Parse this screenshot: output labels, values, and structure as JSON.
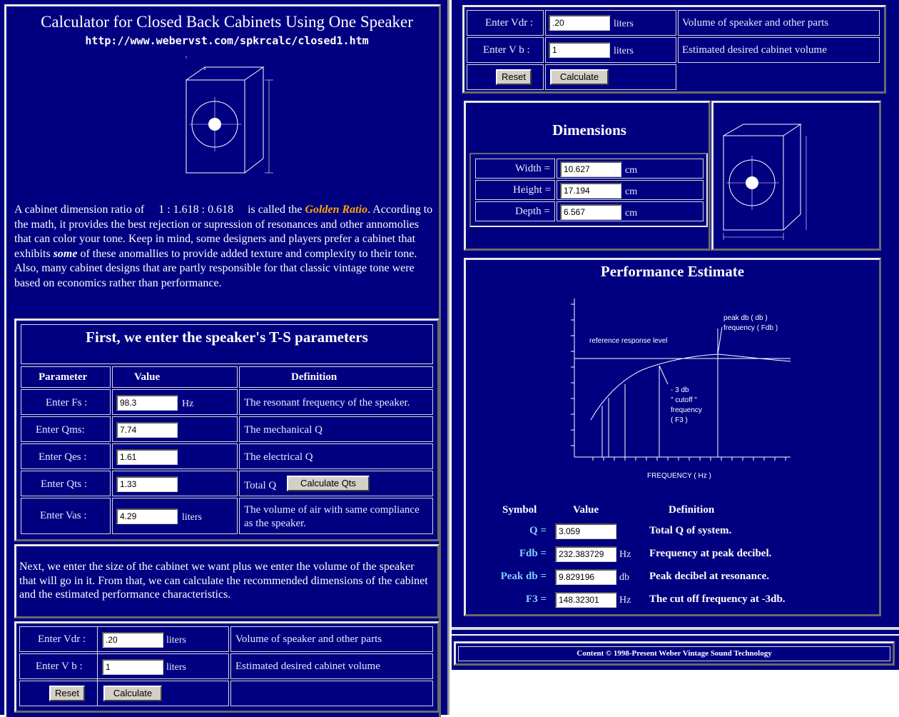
{
  "header": {
    "title": "Calculator for Closed Back Cabinets Using One Speaker",
    "url": "http://www.webervst.com/spkrcalc/closed1.htm"
  },
  "intro": {
    "p1": "A cabinet dimension ratio of",
    "ratio": "1 : 1.618 : 0.618",
    "p2": "is called the",
    "golden": "Golden Ratio",
    "p3": ". According to the math, it provides the best rejection or supression of resonances and other annomolies that can color your tone. Keep in mind, some designers and players prefer a cabinet that exhibits",
    "some": "some",
    "p4": "of these anomallies to provide added texture and complexity to their tone. Also, many cabinet designs that are partly responsible for that classic vintage tone were based on economics rather than performance."
  },
  "ts": {
    "title": "First, we enter the speaker's T-S parameters",
    "headers": [
      "Parameter",
      "Value",
      "Definition"
    ],
    "rows": [
      {
        "label": "Enter Fs :",
        "value": "98.3",
        "unit": "Hz",
        "def": "The resonant frequency of the speaker."
      },
      {
        "label": "Enter Qms:",
        "value": "7.74",
        "unit": "",
        "def": "The mechanical Q"
      },
      {
        "label": "Enter Qes :",
        "value": "1.61",
        "unit": "",
        "def": "The electrical Q"
      },
      {
        "label": "Enter Qts :",
        "value": "1.33",
        "unit": "",
        "def": "Total Q"
      },
      {
        "label": "Enter Vas :",
        "value": "4.29",
        "unit": "liters",
        "def": "The volume of air with same compliance as the speaker."
      }
    ],
    "calc_qts": "Calculate Qts"
  },
  "next_text": "Next, we enter the size of the cabinet we want plus we enter the volume of the speaker that will go in it. From that, we can calculate the recommended dimensions of the cabinet and the estimated performance characteristics.",
  "cabinet": {
    "vdr_label": "Enter Vdr :",
    "vdr_value": ".20",
    "vdr_unit": "liters",
    "vdr_def": "Volume of speaker and other parts",
    "vb_label": "Enter  V b :",
    "vb_value": "1",
    "vb_unit": "liters",
    "vb_def": "Estimated desired cabinet volume",
    "reset": "Reset",
    "calculate": "Calculate"
  },
  "dimensions": {
    "title": "Dimensions",
    "rows": [
      {
        "label": "Width =",
        "value": "10.627",
        "unit": "cm"
      },
      {
        "label": "Height =",
        "value": "17.194",
        "unit": "cm"
      },
      {
        "label": "Depth =",
        "value": "6.567",
        "unit": "cm"
      }
    ]
  },
  "performance": {
    "title": "Performance Estimate",
    "graph": {
      "ref_label": "reference response level",
      "peak_label_1": "peak db ( db )",
      "peak_label_2": "frequency ( Fdb )",
      "cutoff_1": "- 3 db",
      "cutoff_2": "\" cutoff \"",
      "cutoff_3": "frequency",
      "cutoff_4": "( F3 )",
      "xlabel": "FREQUENCY ( Hz )"
    },
    "headers": [
      "Symbol",
      "Value",
      "Definition"
    ],
    "rows": [
      {
        "symbol": "Q =",
        "value": "3.059",
        "unit": "",
        "def": "Total Q of system."
      },
      {
        "symbol": "Fdb =",
        "value": "232.383729",
        "unit": "Hz",
        "def": "Frequency at peak decibel."
      },
      {
        "symbol": "Peak db =",
        "value": "9.829196",
        "unit": "db",
        "def": "Peak decibel at resonance."
      },
      {
        "symbol": "F3 =",
        "value": "148.32301",
        "unit": "Hz",
        "def": "The cut off frequency at -3db."
      }
    ]
  },
  "footer": "Content © 1998-Present Weber Vintage Sound Technology",
  "colors": {
    "background": "#000080",
    "golden": "#ffa500",
    "symbol": "#7fd0ff"
  }
}
